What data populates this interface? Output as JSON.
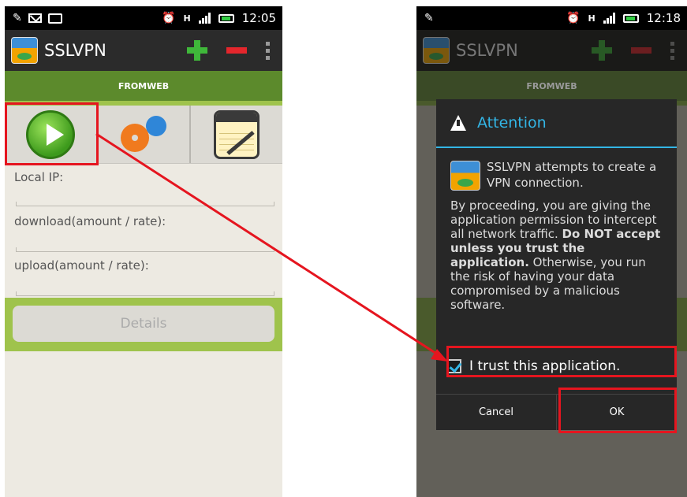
{
  "left_screen": {
    "status": {
      "time": "12:05",
      "network": "H"
    },
    "app_title": "SSLVPN",
    "tab": "FROMWEB",
    "fields": {
      "local_ip": "Local IP:",
      "download": "download(amount / rate):",
      "upload": "upload(amount / rate):"
    },
    "details_button": "Details"
  },
  "right_screen": {
    "status": {
      "time": "12:18",
      "network": "H"
    },
    "app_title": "SSLVPN",
    "tab": "FROMWEB",
    "dialog": {
      "title": "Attention",
      "app_message": "SSLVPN attempts to create a VPN connection.",
      "body_intro": "By proceeding, you are giving the application permission to intercept all network traffic.",
      "body_bold": "Do NOT accept unless you trust the application.",
      "body_outro": "Otherwise, you run the risk of having your data compromised by a malicious software.",
      "trust_label": "I trust this application.",
      "trust_checked": true,
      "cancel": "Cancel",
      "ok": "OK"
    }
  },
  "colors": {
    "annotation_red": "#e5151f",
    "tab_green": "#5c8a2c",
    "accent_blue": "#33b5e5"
  },
  "icons": [
    "notification-icon",
    "mail-icon",
    "camera-icon",
    "alarm-icon",
    "signal-icon",
    "battery-icon",
    "play-icon",
    "settings-gear-icon",
    "notepad-icon",
    "add-icon",
    "remove-icon",
    "overflow-menu-icon",
    "warning-icon"
  ]
}
